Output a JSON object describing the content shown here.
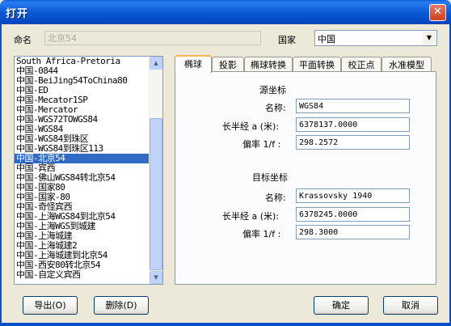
{
  "window": {
    "title": "打开",
    "close_glyph": "✕"
  },
  "name_field": {
    "label": "命名",
    "value": "北京54"
  },
  "country": {
    "label": "国家",
    "selected": "中国"
  },
  "list": {
    "items": [
      "South Africa-Pretoria",
      "中国-0844",
      "中国-BeiJing54ToChina80",
      "中国-ED",
      "中国-Mecator1SP",
      "中国-Mercator",
      "中国-WGS72TOWGS84",
      "中国-WGS84",
      "中国-WGS84到珠区",
      "中国-WGS84到珠区113",
      "中国-北京54",
      "中国-宾西",
      "中国-佛山WGS84转北京54",
      "中国-国家80",
      "中国-国家-80",
      "中国-奇怪宾西",
      "中国-上海WGS84到北京54",
      "中国-上海WGS到城建",
      "中国-上海城建",
      "中国-上海城建2",
      "中国-上海城建到北京54",
      "中国-西安80转北京54",
      "中国-自定义宾西"
    ],
    "selected": "中国-北京54"
  },
  "tabs": [
    {
      "label": "椭球",
      "active": true
    },
    {
      "label": "投影",
      "active": false
    },
    {
      "label": "椭球转换",
      "active": false
    },
    {
      "label": "平面转换",
      "active": false
    },
    {
      "label": "校正点",
      "active": false
    },
    {
      "label": "水准模型",
      "active": false
    }
  ],
  "source": {
    "heading": "源坐标",
    "name_label": "名称:",
    "name_value": "WGS84",
    "semi_major_label": "长半经 a (米):",
    "semi_major_value": "6378137.0000",
    "flattening_label": "偏率 1/f :",
    "flattening_value": "298.2572"
  },
  "target": {
    "heading": "目标坐标",
    "name_label": "名称:",
    "name_value": "Krassovsky 1940",
    "semi_major_label": "长半经 a (米):",
    "semi_major_value": "6378245.0000",
    "flattening_label": "偏率 1/f :",
    "flattening_value": "298.3000"
  },
  "buttons": {
    "export": "导出(O)",
    "delete": "删除(D)",
    "ok": "确定",
    "cancel": "取消"
  }
}
